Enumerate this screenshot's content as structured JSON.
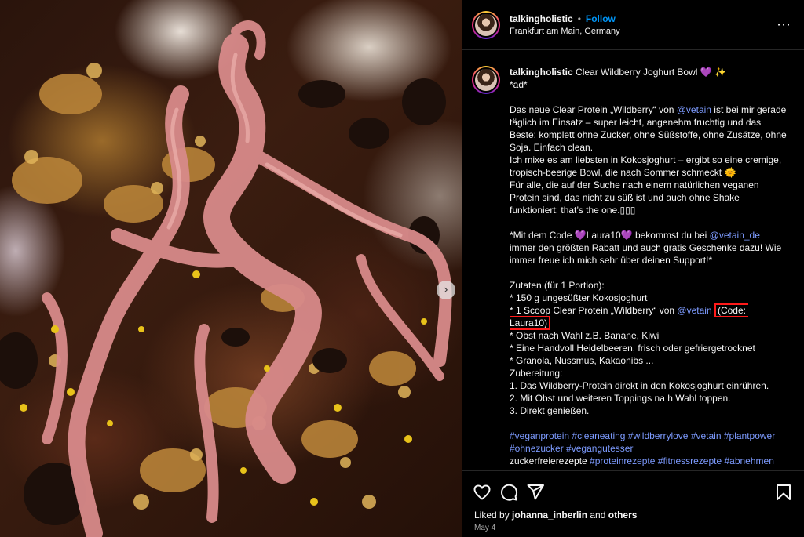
{
  "header": {
    "username": "talkingholistic",
    "separator": "•",
    "follow_label": "Follow",
    "location": "Frankfurt am Main, Germany",
    "more_icon": "⋯"
  },
  "caption": {
    "username": "talkingholistic",
    "title": "Clear Wildberry Joghurt Bowl 💜 ✨",
    "ad": "*ad*",
    "p1_a": "Das neue Clear Protein „Wildberry“ von ",
    "p1_mention": "@vetain",
    "p1_b": " ist bei mir gerade täglich im Einsatz – super leicht, angenehm fruchtig und das Beste: komplett ohne Zucker, ohne Süßstoffe, ohne Zusätze, ohne Soja. Einfach clean.",
    "p2": "Ich mixe es am liebsten in Kokosjoghurt – ergibt so eine cremige, tropisch-beerige Bowl, die nach Sommer schmeckt 🌞",
    "p3": "Für alle, die auf der Suche nach einem natürlichen veganen Protein sind, das nicht zu süß ist und auch ohne Shake funktioniert: that’s the one.▯▯▯",
    "code_a": "*Mit dem Code 💜Laura10💜 bekommst du bei ",
    "code_mention": "@vetain_de",
    "code_b": " immer den größten Rabatt und auch gratis Geschenke dazu! Wie immer freue ich mich sehr über deinen Support!*",
    "zutaten_title": "Zutaten (für 1 Portion):",
    "z1": "* 150 g ungesüßter Kokosjoghurt",
    "z2_a": "* 1 Scoop Clear Protein „Wildberry“ von ",
    "z2_mention": "@vetain",
    "z2_code": "(Code: Laura10)",
    "z3": "* Obst nach Wahl z.B. Banane, Kiwi",
    "z4": "* Eine Handvoll Heidelbeeren, frisch oder gefriergetrocknet",
    "z5": "* Granola, Nussmus, Kakaonibs ...",
    "zubereitung_title": "Zubereitung:",
    "s1": "1. Das Wildberry-Protein direkt in den Kokosjoghurt einrühren.",
    "s2": "2. Mit Obst und weiteren Toppings na h Wahl toppen.",
    "s3": "3. Direkt genießen.",
    "hashtags_1": "#veganprotein #cleaneating #wildberrylove #vetain #plantpower #ohnezucker #vegangutesser",
    "hashtags_2a": "zuckerfreierezepte ",
    "hashtags_2b": "#proteinrezepte #fitnessrezepte #abnehmen #abnehmrezepte #gesunderezepte #gewinnspiel #gesundeernährung #protein #morenutrition #schnellerezepte #einfacherezepte #prote"
  },
  "footer": {
    "liked_prefix": "Liked by ",
    "liked_user": "johanna_inberlin",
    "liked_and": " and ",
    "liked_others": "others",
    "date": "May 4"
  },
  "carousel": {
    "next_icon": "›"
  },
  "colors": {
    "accent": "#0095f6",
    "link": "#7d9bff",
    "highlight": "#ff1a1a",
    "background": "#000000"
  }
}
